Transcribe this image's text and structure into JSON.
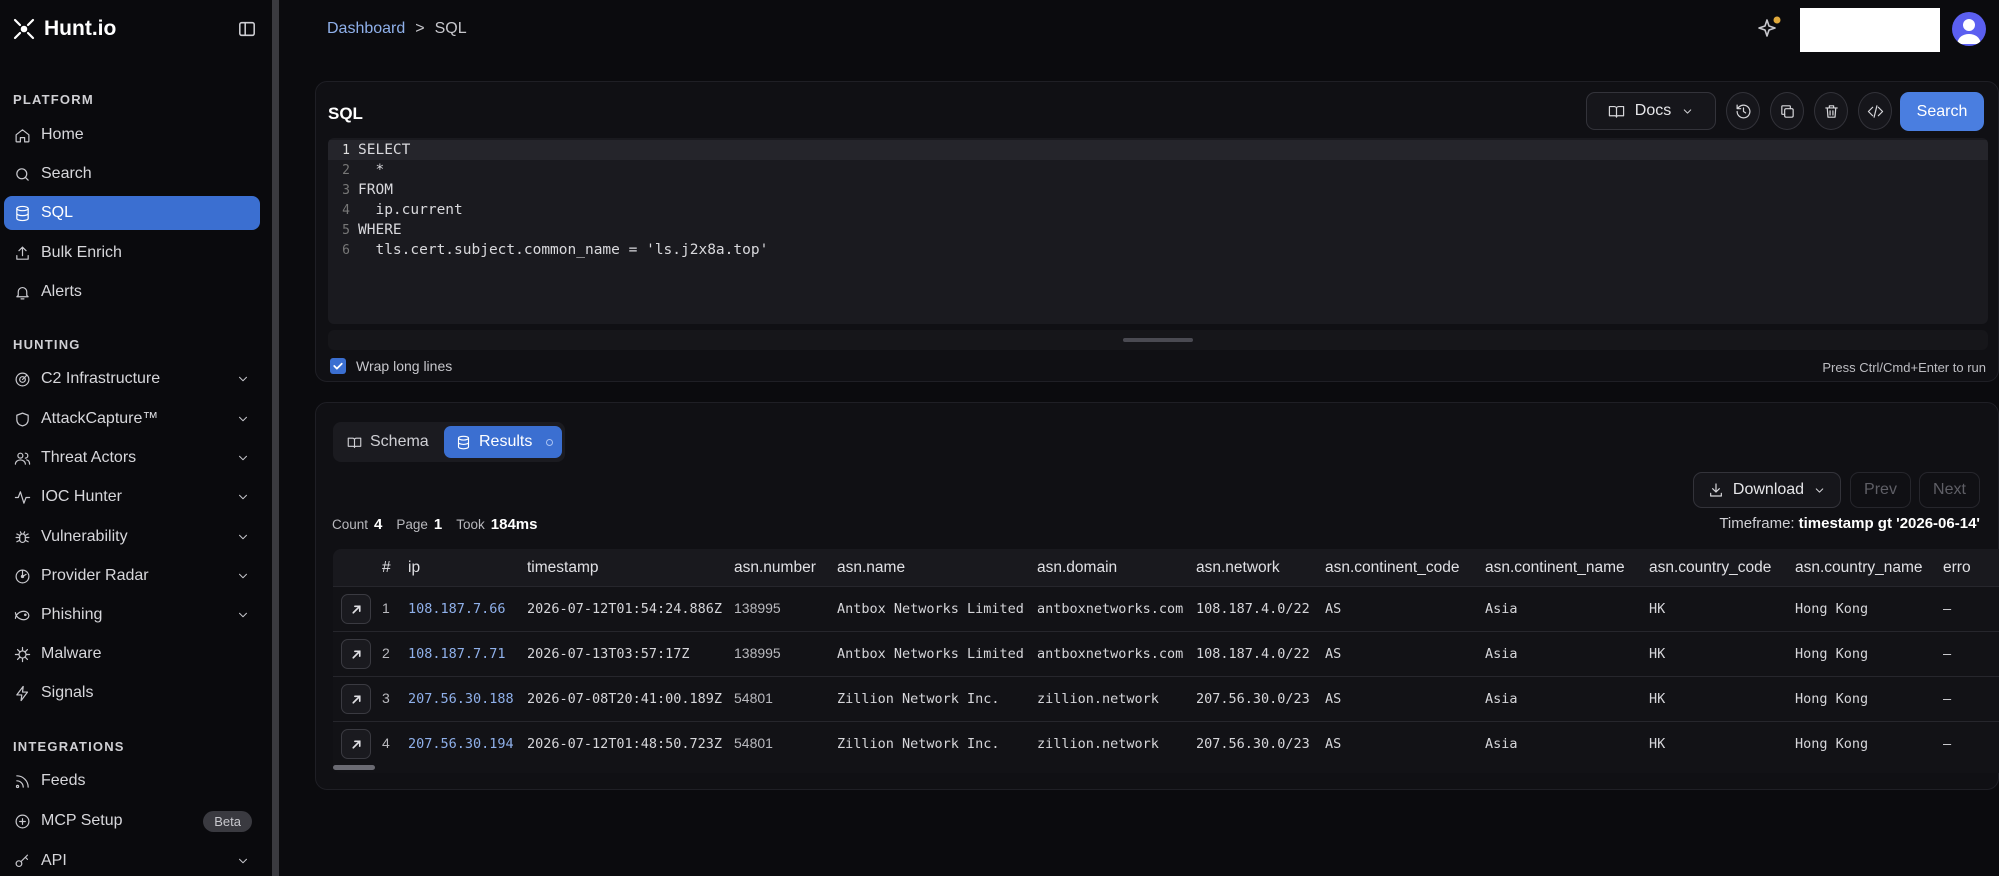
{
  "app": {
    "name": "Hunt.io"
  },
  "sidebar": {
    "sections": [
      {
        "title": "PLATFORM"
      },
      {
        "title": "HUNTING"
      },
      {
        "title": "INTEGRATIONS"
      }
    ],
    "items": [
      {
        "label": "Home"
      },
      {
        "label": "Search"
      },
      {
        "label": "SQL"
      },
      {
        "label": "Bulk Enrich"
      },
      {
        "label": "Alerts"
      },
      {
        "label": "C2 Infrastructure"
      },
      {
        "label": "AttackCapture™"
      },
      {
        "label": "Threat Actors"
      },
      {
        "label": "IOC Hunter"
      },
      {
        "label": "Vulnerability"
      },
      {
        "label": "Provider Radar"
      },
      {
        "label": "Phishing"
      },
      {
        "label": "Malware"
      },
      {
        "label": "Signals"
      },
      {
        "label": "Feeds"
      },
      {
        "label": "MCP Setup",
        "badge": "Beta"
      },
      {
        "label": "API"
      }
    ]
  },
  "breadcrumb": {
    "parent": "Dashboard",
    "separator": ">",
    "current": "SQL"
  },
  "sql_panel": {
    "title": "SQL",
    "docs_label": "Docs",
    "search_label": "Search",
    "lines": [
      {
        "n": "1",
        "kw": "SELECT",
        "text": ""
      },
      {
        "n": "2",
        "kw": "",
        "text": "  *"
      },
      {
        "n": "3",
        "kw": "FROM",
        "text": ""
      },
      {
        "n": "4",
        "kw": "",
        "text": "  ip.current"
      },
      {
        "n": "5",
        "kw": "WHERE",
        "text": ""
      },
      {
        "n": "6",
        "kw": "",
        "text": "  tls.cert.subject.common_name = ",
        "str": "'ls.j2x8a.top'"
      }
    ],
    "wrap_label": "Wrap long lines",
    "run_hint": "Press Ctrl/Cmd+Enter to run"
  },
  "results_panel": {
    "tabs": {
      "schema": "Schema",
      "results": "Results"
    },
    "download_label": "Download",
    "prev_label": "Prev",
    "next_label": "Next",
    "stats": {
      "count_label": "Count",
      "count": "4",
      "page_label": "Page",
      "page": "1",
      "took_label": "Took",
      "took": "184ms"
    },
    "timeframe": {
      "label": "Timeframe:",
      "value": "timestamp gt '2026-06-14'"
    },
    "columns": [
      "#",
      "ip",
      "timestamp",
      "asn.number",
      "asn.name",
      "asn.domain",
      "asn.network",
      "asn.continent_code",
      "asn.continent_name",
      "asn.country_code",
      "asn.country_name",
      "erro"
    ],
    "rows": [
      [
        "1",
        "108.187.7.66",
        "2026-07-12T01:54:24.886Z",
        "138995",
        "Antbox Networks Limited",
        "antboxnetworks.com",
        "108.187.4.0/22",
        "AS",
        "Asia",
        "HK",
        "Hong Kong",
        "–"
      ],
      [
        "2",
        "108.187.7.71",
        "2026-07-13T03:57:17Z",
        "138995",
        "Antbox Networks Limited",
        "antboxnetworks.com",
        "108.187.4.0/22",
        "AS",
        "Asia",
        "HK",
        "Hong Kong",
        "–"
      ],
      [
        "3",
        "207.56.30.188",
        "2026-07-08T20:41:00.189Z",
        "54801",
        "Zillion Network Inc.",
        "zillion.network",
        "207.56.30.0/23",
        "AS",
        "Asia",
        "HK",
        "Hong Kong",
        "–"
      ],
      [
        "4",
        "207.56.30.194",
        "2026-07-12T01:48:50.723Z",
        "54801",
        "Zillion Network Inc.",
        "zillion.network",
        "207.56.30.0/23",
        "AS",
        "Asia",
        "HK",
        "Hong Kong",
        "–"
      ]
    ]
  },
  "colors": {
    "accent": "#3b6fd1",
    "link": "#8fb0ea",
    "background": "#0b0b0e"
  }
}
